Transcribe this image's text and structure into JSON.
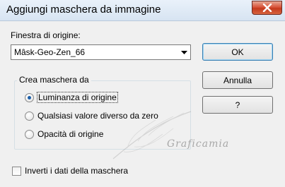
{
  "window": {
    "title": "Aggiungi maschera da immagine",
    "close_icon": "close-icon"
  },
  "origin": {
    "label": "Finestra di origine:",
    "selected": "Mâsk-Geo-Zen_66"
  },
  "buttons": {
    "ok": "OK",
    "cancel": "Annulla",
    "help": "?"
  },
  "mask_group": {
    "label": "Crea maschera da",
    "options": [
      {
        "label": "Luminanza di origine",
        "checked": true
      },
      {
        "label": "Qualsiasi valore diverso da zero",
        "checked": false
      },
      {
        "label": "Opacità di origine",
        "checked": false
      }
    ]
  },
  "invert": {
    "label": "Inverti i dati della maschera",
    "checked": false
  },
  "watermark": {
    "text": "Graficamia"
  },
  "colors": {
    "accent": "#1a5da8",
    "close_red": "#c43a1e",
    "background": "#f0f0f0"
  }
}
